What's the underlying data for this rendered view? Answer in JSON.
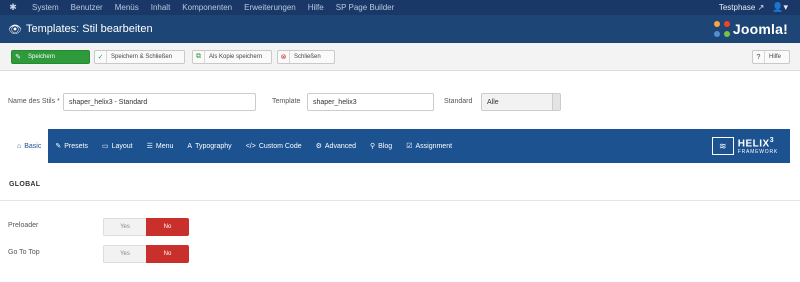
{
  "topbar": {
    "menu": [
      "System",
      "Benutzer",
      "Menüs",
      "Inhalt",
      "Komponenten",
      "Erweiterungen",
      "Hilfe",
      "SP Page Builder"
    ],
    "site_name": "Testphase",
    "user_icon": "user-icon"
  },
  "header": {
    "title": "Templates: Stil bearbeiten",
    "brand": "Joomla!"
  },
  "toolbar": {
    "save_label": "Speichern",
    "save_close_label": "Speichern & Schließen",
    "save_copy_label": "Als Kopie speichern",
    "close_label": "Schließen",
    "help_label": "Hilfe"
  },
  "form": {
    "style_name_label": "Name des Stils *",
    "style_name_value": "shaper_helix3 - Standard",
    "template_label": "Template",
    "template_value": "shaper_helix3",
    "default_label": "Standard",
    "default_value": "Alle"
  },
  "tabs": [
    {
      "label": "Basic",
      "icon": "home-icon"
    },
    {
      "label": "Presets",
      "icon": "brush-icon"
    },
    {
      "label": "Layout",
      "icon": "layout-icon"
    },
    {
      "label": "Menu",
      "icon": "list-icon"
    },
    {
      "label": "Typography",
      "icon": "font-icon"
    },
    {
      "label": "Custom Code",
      "icon": "code-icon"
    },
    {
      "label": "Advanced",
      "icon": "gear-icon"
    },
    {
      "label": "Blog",
      "icon": "pin-icon"
    },
    {
      "label": "Assignment",
      "icon": "assign-icon"
    }
  ],
  "helix": {
    "name": "HELIX",
    "version": "3",
    "sub": "FRAMEWORK"
  },
  "section": {
    "title": "GLOBAL"
  },
  "options": [
    {
      "label": "Preloader",
      "yes": "Yes",
      "no": "No",
      "value": "No"
    },
    {
      "label": "Go To Top",
      "yes": "Yes",
      "no": "No",
      "value": "No"
    }
  ],
  "colors": {
    "topbar": "#1a3867",
    "header": "#1d4677",
    "tabs": "#1c5290",
    "save_green": "#2f9a3b",
    "toggle_no": "#c9302c"
  }
}
